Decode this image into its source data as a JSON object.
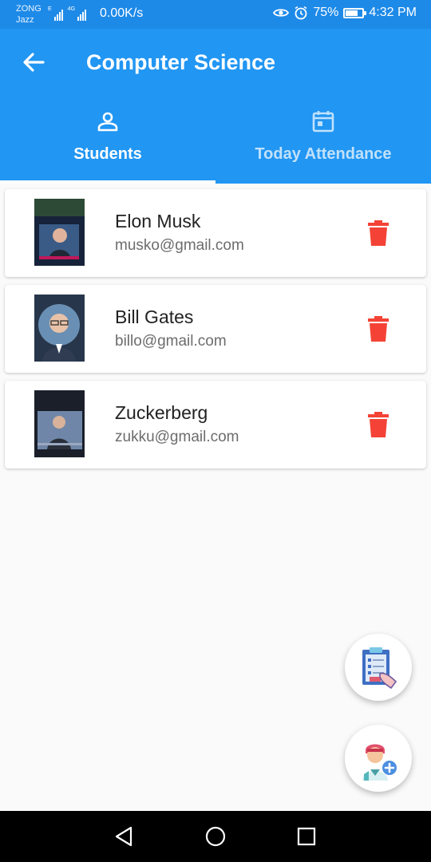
{
  "status_bar": {
    "carrier_top": "ZONG",
    "carrier_bottom": "Jazz",
    "net_tag": "E",
    "net_tag2": "4G",
    "speed": "0.00K/s",
    "battery": "75%",
    "battery_level": 0.75,
    "time": "4:32 PM"
  },
  "app_bar": {
    "title": "Computer Science",
    "tabs": [
      {
        "label": "Students",
        "icon": "person-icon",
        "selected": true
      },
      {
        "label": "Today Attendance",
        "icon": "calendar-icon",
        "selected": false
      }
    ]
  },
  "students": [
    {
      "name": "Elon Musk",
      "email": "musko@gmail.com"
    },
    {
      "name": "Bill Gates",
      "email": "billo@gmail.com"
    },
    {
      "name": "Zuckerberg",
      "email": "zukku@gmail.com"
    }
  ],
  "fabs": [
    {
      "icon": "clipboard-attendance-icon"
    },
    {
      "icon": "add-student-icon"
    }
  ],
  "colors": {
    "primary": "#2196f3",
    "status_bar": "#1e8ae8",
    "delete": "#f44336"
  }
}
